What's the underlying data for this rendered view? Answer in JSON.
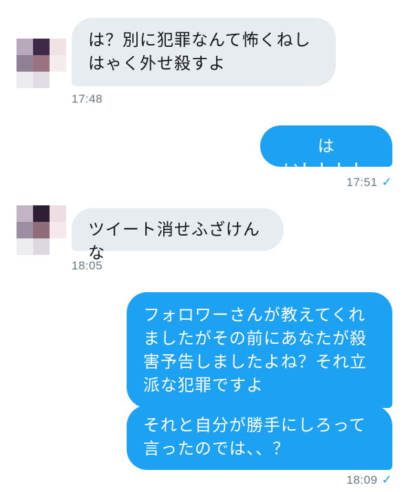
{
  "conversation": {
    "messages": [
      {
        "direction": "incoming",
        "text": "は？別に犯罪なんて怖くねしはゃく外せ殺すよ",
        "timestamp": "17:48"
      },
      {
        "direction": "outgoing",
        "text": "はい！！！！",
        "timestamp": "17:51",
        "read_icon": "checkmark-icon"
      },
      {
        "direction": "incoming",
        "text": "ツイート消せふざけんな",
        "timestamp": "18:05"
      },
      {
        "direction": "outgoing",
        "text": "フォロワーさんが教えてくれましたがその前にあなたが殺害予告しましたよね？それ立派な犯罪ですよ"
      },
      {
        "direction": "outgoing",
        "text": "それと自分が勝手にしろって言ったのでは、、？",
        "timestamp": "18:09",
        "read_icon": "checkmark-icon"
      }
    ],
    "check_glyph": "✓"
  },
  "colors": {
    "incoming_bubble": "#e6ecf0",
    "outgoing_bubble": "#1da1f2",
    "timestamp": "#657786",
    "accent": "#1da1f2"
  }
}
